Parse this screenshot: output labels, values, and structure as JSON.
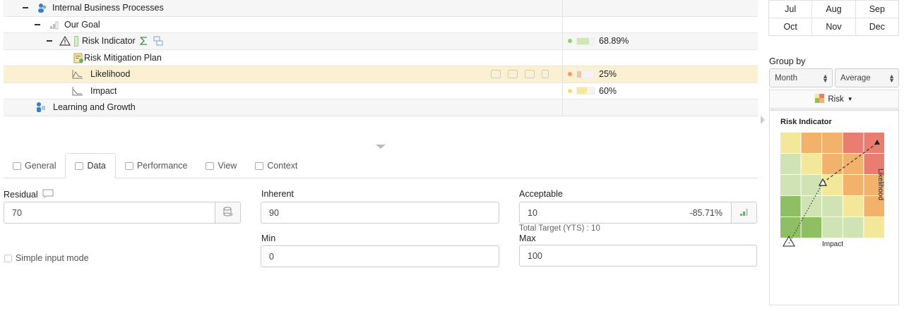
{
  "tree": {
    "rows": [
      {
        "label": "Internal Business Processes",
        "icon": "group-people-icon"
      },
      {
        "label": "Our Goal",
        "icon": "goal-bar-icon"
      },
      {
        "label": "Risk Indicator",
        "icon": "warning-triangle-icon",
        "value": "68.89%",
        "status_color": "#8fd16a",
        "fill": 0.6889
      },
      {
        "label": "Risk Mitigation Plan",
        "icon": "mitigation-plan-icon"
      },
      {
        "label": "Likelihood",
        "icon": "line-chart-icon",
        "value": "25%",
        "status_color": "#f09a6e",
        "fill": 0.25
      },
      {
        "label": "Impact",
        "icon": "line-chart-icon",
        "value": "60%",
        "status_color": "#f6dd6b",
        "fill": 0.6
      },
      {
        "label": "Learning and Growth",
        "icon": "learner-icon"
      }
    ]
  },
  "tabs": [
    {
      "label": "General",
      "icon": "general-icon"
    },
    {
      "label": "Data",
      "icon": "data-icon",
      "active": true
    },
    {
      "label": "Performance",
      "icon": "performance-icon"
    },
    {
      "label": "View",
      "icon": "view-icon"
    },
    {
      "label": "Context",
      "icon": "context-icon"
    }
  ],
  "form": {
    "residual_label": "Residual",
    "residual_value": "70",
    "inherent_label": "Inherent",
    "inherent_value": "90",
    "acceptable_label": "Acceptable",
    "acceptable_value": "10",
    "acceptable_variance": "-85.71%",
    "total_target": "Total Target (YTS) : 10",
    "min_label": "Min",
    "min_value": "0",
    "max_label": "Max",
    "max_value": "100",
    "simple_input_label": "Simple input mode"
  },
  "months": [
    [
      "Jul",
      "Aug",
      "Sep"
    ],
    [
      "Oct",
      "Nov",
      "Dec"
    ]
  ],
  "group_by": {
    "label": "Group by",
    "period": "Month",
    "aggregation": "Average",
    "view_button": "Risk"
  },
  "risk_chart": {
    "title": "Risk Indicator",
    "x_label": "Impact",
    "y_label": "Likelihood"
  },
  "colors": {
    "highlight_row": "#fbf0d2",
    "heat_green_dark": "#8fbf63",
    "heat_green": "#cfe3b4",
    "heat_yellow": "#f3e89a",
    "heat_orange": "#f3b26c",
    "heat_red": "#ea7d72"
  }
}
